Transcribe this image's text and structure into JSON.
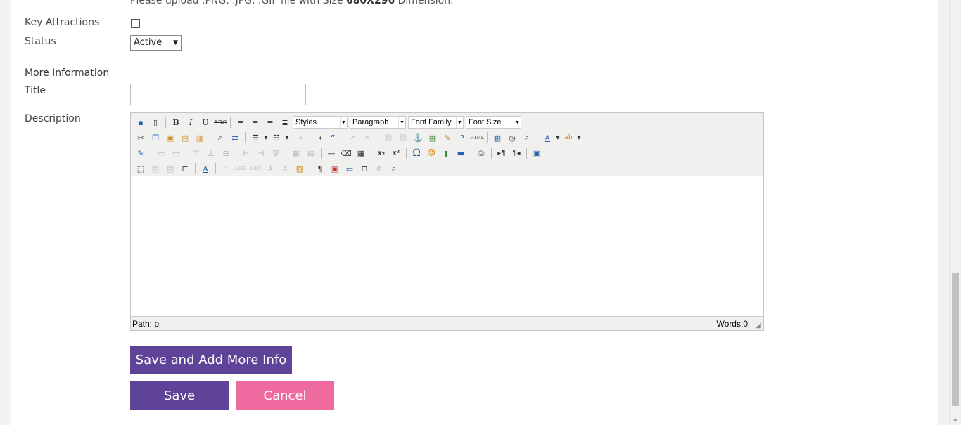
{
  "form": {
    "upload_note_prefix": "Please upload .PNG, .JPG, .GIF file with Size ",
    "upload_note_size": "680X296",
    "upload_note_suffix": " Dimension.",
    "key_attractions_label": "Key Attractions",
    "key_attractions_checked": false,
    "status_label": "Status",
    "status_value": "Active",
    "section_title": "More Information",
    "title_label": "Title",
    "title_value": "",
    "description_label": "Description"
  },
  "editor": {
    "dropdowns": {
      "styles": "Styles",
      "format": "Paragraph",
      "font_family": "Font Family",
      "font_size": "Font Size"
    },
    "status_path": "Path: p",
    "word_count": "Words:0"
  },
  "buttons": {
    "save_more": "Save and Add More Info",
    "save": "Save",
    "cancel": "Cancel"
  },
  "colors": {
    "primary": "#5f4398",
    "cancel": "#ef6a9e"
  }
}
